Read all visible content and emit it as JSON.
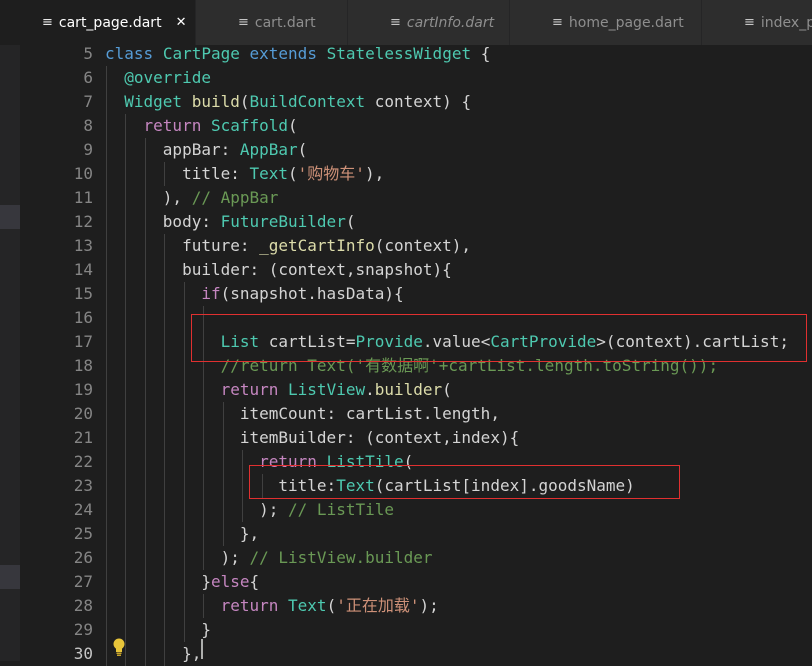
{
  "tabs": [
    {
      "label": "cart_page.dart",
      "active": true,
      "close": "✕",
      "icon": "≡"
    },
    {
      "label": "cart.dart",
      "active": false,
      "icon": "≡"
    },
    {
      "label": "cartInfo.dart",
      "active": false,
      "italic": true,
      "icon": "≡"
    },
    {
      "label": "home_page.dart",
      "active": false,
      "icon": "≡"
    },
    {
      "label": "index_pag",
      "active": false,
      "icon": "≡"
    }
  ],
  "editor": {
    "current_line": "30",
    "lines": [
      {
        "n": "5",
        "indent": 0,
        "tokens": [
          [
            "class",
            "k"
          ],
          [
            " ",
            ""
          ],
          [
            "CartPage",
            "t"
          ],
          [
            " ",
            ""
          ],
          [
            "extends",
            "k"
          ],
          [
            " ",
            ""
          ],
          [
            "StatelessWidget",
            "t"
          ],
          [
            " {",
            "p"
          ]
        ]
      },
      {
        "n": "6",
        "indent": 2,
        "tokens": [
          [
            "@override",
            "t"
          ]
        ]
      },
      {
        "n": "7",
        "indent": 2,
        "tokens": [
          [
            "Widget",
            "t"
          ],
          [
            " ",
            ""
          ],
          [
            "build",
            "f"
          ],
          [
            "(",
            "p"
          ],
          [
            "BuildContext",
            "t"
          ],
          [
            " context) {",
            "p"
          ]
        ]
      },
      {
        "n": "8",
        "indent": 4,
        "tokens": [
          [
            "return",
            "kc"
          ],
          [
            " ",
            ""
          ],
          [
            "Scaffold",
            "t"
          ],
          [
            "(",
            "p"
          ]
        ]
      },
      {
        "n": "9",
        "indent": 6,
        "tokens": [
          [
            "appBar: ",
            "p"
          ],
          [
            "AppBar",
            "t"
          ],
          [
            "(",
            "p"
          ]
        ]
      },
      {
        "n": "10",
        "indent": 8,
        "tokens": [
          [
            "title: ",
            "p"
          ],
          [
            "Text",
            "t"
          ],
          [
            "(",
            "p"
          ],
          [
            "'购物车'",
            "s"
          ],
          [
            "),",
            "p"
          ]
        ]
      },
      {
        "n": "11",
        "indent": 6,
        "tokens": [
          [
            "), ",
            "p"
          ],
          [
            "// AppBar",
            "c"
          ]
        ]
      },
      {
        "n": "12",
        "indent": 6,
        "tokens": [
          [
            "body: ",
            "p"
          ],
          [
            "FutureBuilder",
            "t"
          ],
          [
            "(",
            "p"
          ]
        ]
      },
      {
        "n": "13",
        "indent": 8,
        "tokens": [
          [
            "future: ",
            "p"
          ],
          [
            "_getCartInfo",
            "f"
          ],
          [
            "(context),",
            "p"
          ]
        ]
      },
      {
        "n": "14",
        "indent": 8,
        "tokens": [
          [
            "builder: (context,snapshot){",
            "p"
          ]
        ]
      },
      {
        "n": "15",
        "indent": 10,
        "tokens": [
          [
            "if",
            "kc"
          ],
          [
            "(snapshot.hasData){",
            "p"
          ]
        ]
      },
      {
        "n": "16",
        "indent": 0,
        "tokens": []
      },
      {
        "n": "17",
        "indent": 12,
        "tokens": [
          [
            "List",
            "t"
          ],
          [
            " cartList=",
            "p"
          ],
          [
            "Provide",
            "t"
          ],
          [
            ".value<",
            "p"
          ],
          [
            "CartProvide",
            "t"
          ],
          [
            ">(context).cartList;",
            "p"
          ]
        ]
      },
      {
        "n": "18",
        "indent": 12,
        "tokens": [
          [
            "//return Text('有数据啊'+cartList.length.toString());",
            "c"
          ]
        ]
      },
      {
        "n": "19",
        "indent": 12,
        "tokens": [
          [
            "return",
            "kc"
          ],
          [
            " ",
            ""
          ],
          [
            "ListView",
            "t"
          ],
          [
            ".",
            "p"
          ],
          [
            "builder",
            "f"
          ],
          [
            "(",
            "p"
          ]
        ]
      },
      {
        "n": "20",
        "indent": 14,
        "tokens": [
          [
            "itemCount: cartList.length,",
            "p"
          ]
        ]
      },
      {
        "n": "21",
        "indent": 14,
        "tokens": [
          [
            "itemBuilder: (context,index){",
            "p"
          ]
        ]
      },
      {
        "n": "22",
        "indent": 16,
        "tokens": [
          [
            "return",
            "kc"
          ],
          [
            " ",
            ""
          ],
          [
            "ListTile",
            "t"
          ],
          [
            "(",
            "p"
          ]
        ]
      },
      {
        "n": "23",
        "indent": 18,
        "tokens": [
          [
            "title:",
            "p"
          ],
          [
            "Text",
            "t"
          ],
          [
            "(cartList[index].goodsName)",
            "p"
          ]
        ]
      },
      {
        "n": "24",
        "indent": 16,
        "tokens": [
          [
            "); ",
            "p"
          ],
          [
            "// ListTile",
            "c"
          ]
        ]
      },
      {
        "n": "25",
        "indent": 14,
        "tokens": [
          [
            "},",
            "p"
          ]
        ]
      },
      {
        "n": "26",
        "indent": 12,
        "tokens": [
          [
            "); ",
            "p"
          ],
          [
            "// ListView.builder",
            "c"
          ]
        ]
      },
      {
        "n": "27",
        "indent": 10,
        "tokens": [
          [
            "}",
            "p"
          ],
          [
            "else",
            "kc"
          ],
          [
            "{",
            "p"
          ]
        ]
      },
      {
        "n": "28",
        "indent": 12,
        "tokens": [
          [
            "return",
            "kc"
          ],
          [
            " ",
            ""
          ],
          [
            "Text",
            "t"
          ],
          [
            "(",
            "p"
          ],
          [
            "'正在加载'",
            "s"
          ],
          [
            ");",
            "p"
          ]
        ]
      },
      {
        "n": "29",
        "indent": 10,
        "tokens": [
          [
            "}",
            "p"
          ]
        ]
      },
      {
        "n": "30",
        "indent": 8,
        "tokens": [
          [
            "},",
            "p"
          ]
        ]
      }
    ]
  },
  "highlights": [
    {
      "line": "17",
      "label": "cartList assignment"
    },
    {
      "line": "23",
      "label": "ListTile title"
    }
  ],
  "lightbulb_icon": "lightbulb-icon",
  "colors": {
    "keyword": "#569cd6",
    "control": "#c586c0",
    "type": "#4ec9b0",
    "function": "#dcdcaa",
    "string": "#ce9178",
    "comment": "#6a9955",
    "text": "#d4d4d4",
    "highlight_box": "#e03030"
  }
}
